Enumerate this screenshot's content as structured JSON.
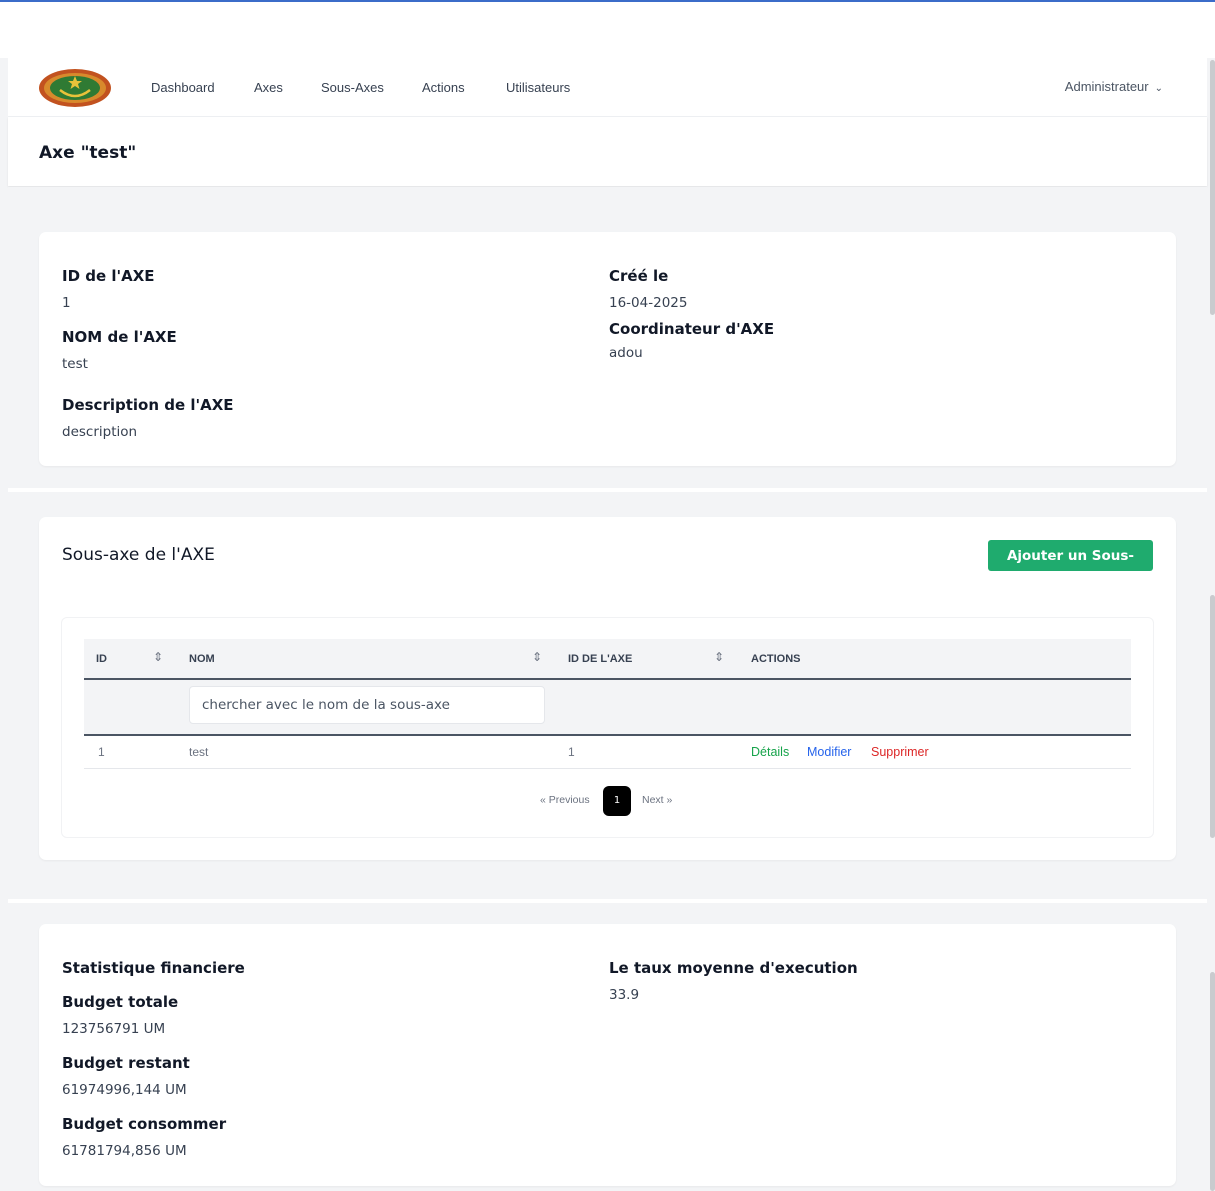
{
  "nav": {
    "items": [
      "Dashboard",
      "Axes",
      "Sous-Axes",
      "Actions",
      "Utilisateurs"
    ],
    "user": "Administrateur"
  },
  "page": {
    "title": "Axe \"test\""
  },
  "axe_info": {
    "id_label": "ID de l'AXE",
    "id_value": "1",
    "nom_label": "NOM de l'AXE",
    "nom_value": "test",
    "desc_label": "Description de l'AXE",
    "desc_value": "description",
    "created_label": "Créé le",
    "created_value": "16-04-2025",
    "coord_label": "Coordinateur d'AXE",
    "coord_value": "adou"
  },
  "sous_axes": {
    "title": "Sous-axe de l'AXE",
    "add_button": "Ajouter un Sous-Axe",
    "columns": [
      "ID",
      "NOM",
      "ID DE L'AXE",
      "ACTIONS"
    ],
    "search_placeholder": "chercher avec le nom de la sous-axe",
    "rows": [
      {
        "id": "1",
        "nom": "test",
        "axe_id": "1"
      }
    ],
    "actions": {
      "details": "Détails",
      "modifier": "Modifier",
      "supprimer": "Supprimer"
    },
    "pagination": {
      "previous": "« Previous",
      "current": "1",
      "next": "Next »"
    }
  },
  "stats": {
    "title": "Statistique financiere",
    "budget_total_label": "Budget totale",
    "budget_total_value": "123756791 UM",
    "budget_rest_label": "Budget restant",
    "budget_rest_value": "61974996,144 UM",
    "budget_cons_label": "Budget consommer",
    "budget_cons_value": "61781794,856 UM",
    "taux_label": "Le taux moyenne d'execution",
    "taux_value": "33.9"
  },
  "colors": {
    "accent_green": "#1fab6e",
    "details_green": "#16a34a",
    "modifier_blue": "#2563eb",
    "supprimer_red": "#dc2626"
  }
}
